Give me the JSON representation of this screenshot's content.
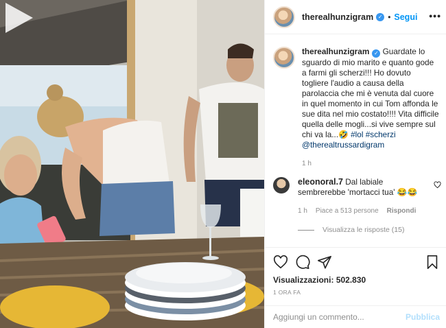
{
  "post": {
    "author": "therealhunzigram",
    "follow_label": "Segui",
    "dot": "•",
    "more_label": "•••"
  },
  "caption": {
    "author": "therealhunzigram",
    "text_before": "Guardate lo sguardo di mio marito e quanto gode a farmi gli scherzi!!! Ho dovuto togliere l'audio a causa della parolaccia che mi è venuta dal cuore in quel momento in cui Tom affonda le sue dita nel mio costato!!!! Vita difficile quella delle mogli...si vive sempre sul chi va la...🤣 ",
    "hashtag_lol": "#lol",
    "hashtag_scherzi": "#scherzi",
    "mention": "@therealtrussardigram",
    "time": "1 h"
  },
  "comments": [
    {
      "author": "eleonoral.7",
      "text": "Dal labiale sembrerebbe 'mortacci tua' 😂😂",
      "time": "1 h",
      "likes": "Piace a 513 persone",
      "reply_label": "Rispondi"
    }
  ],
  "view_replies_label": "Visualizza le risposte (15)",
  "actions": {
    "like_icon": "heart-outline",
    "comment_icon": "speech-bubble",
    "share_icon": "paper-plane",
    "save_icon": "bookmark"
  },
  "stats": {
    "views_label": "Visualizzazioni:",
    "views_count": "502.830",
    "posted_ago": "1 ORA FA"
  },
  "add_comment": {
    "placeholder": "Aggiungi un commento...",
    "publish_label": "Pubblica"
  },
  "colors": {
    "link_blue": "#0095f6",
    "verified_blue": "#3897f0",
    "muted_text": "#8e8e8e",
    "publish_disabled": "#b2dffc"
  }
}
